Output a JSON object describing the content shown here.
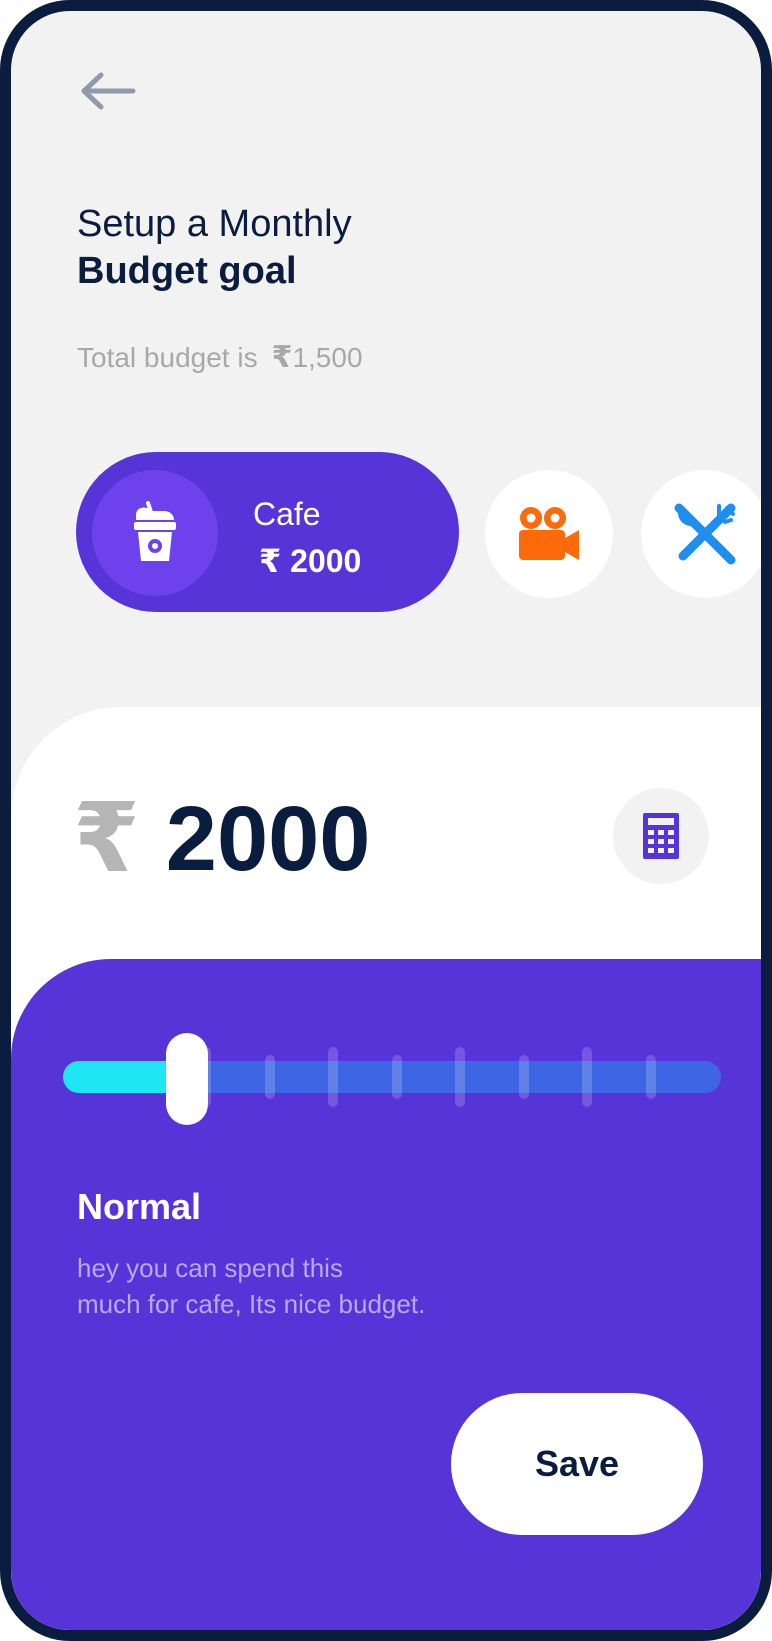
{
  "header": {
    "back_icon": "arrow-left-icon",
    "title_line1": "Setup a Monthly",
    "title_line2": "Budget goal"
  },
  "total_budget": {
    "label": "Total budget is",
    "currency": "₹",
    "amount": "1,500"
  },
  "categories": [
    {
      "label": "Cafe",
      "currency": "₹",
      "amount": "2000",
      "icon": "cafe-cup-icon",
      "selected": true
    },
    {
      "label": "",
      "icon": "movie-camera-icon",
      "selected": false
    },
    {
      "label": "",
      "icon": "fork-knife-icon",
      "selected": false
    }
  ],
  "amount_display": {
    "currency": "₹",
    "value": "2000",
    "calculator_icon": "calculator-icon"
  },
  "slider": {
    "level": 0.14,
    "ticks": 8
  },
  "level_info": {
    "title": "Normal",
    "desc_line1": "hey you can spend this",
    "desc_line2": "much for cafe, Its nice budget."
  },
  "actions": {
    "save_label": "Save"
  },
  "colors": {
    "navy": "#0b1d3e",
    "purple": "#5734d8",
    "accent_cyan": "#1fe6f3",
    "orange": "#fd6a09",
    "blue": "#1f8ef1"
  }
}
